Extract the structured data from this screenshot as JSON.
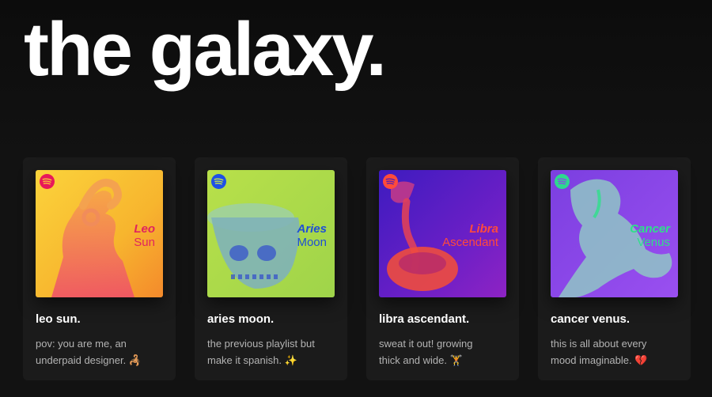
{
  "page_title": "the galaxy.",
  "cards": [
    {
      "name": "leo sun.",
      "sign": "Leo",
      "placement": "Sun",
      "line1": "pov: you are me, an",
      "line2": "underpaid designer. 🦂",
      "sign_color": "#e0245e",
      "place_color": "#e0245e",
      "logo_color": "#e8185a",
      "logo_mark": "#f7c23a"
    },
    {
      "name": "aries moon.",
      "sign": "Aries",
      "placement": "Moon",
      "line1": "the previous playlist but",
      "line2": "make it spanish. ✨",
      "sign_color": "#1e4fd6",
      "place_color": "#1e4fd6",
      "logo_color": "#1e50e6",
      "logo_mark": "#c7e54a"
    },
    {
      "name": "libra ascendant.",
      "sign": "Libra",
      "placement": "Ascendant",
      "line1": "sweat it out! growing",
      "line2": "thick and wide. 🏋",
      "sign_color": "#ff4a3d",
      "place_color": "#ff4a3d",
      "logo_color": "#ff4b3a",
      "logo_mark": "#5a1fb0"
    },
    {
      "name": "cancer venus.",
      "sign": "Cancer",
      "placement": "Venus",
      "line1": "this is all about every",
      "line2": "mood imaginable. 💔",
      "sign_color": "#2ee08a",
      "place_color": "#2ee08a",
      "logo_color": "#2ed890",
      "logo_mark": "#8a47e8"
    }
  ]
}
